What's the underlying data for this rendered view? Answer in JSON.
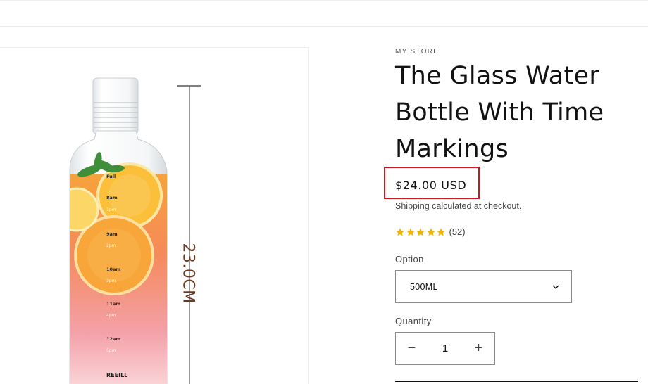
{
  "product": {
    "vendor": "MY STORE",
    "title": "The Glass Water Bottle With Time Markings",
    "price": "$24.00 USD",
    "shipping_link": "Shipping",
    "shipping_rest": " calculated at checkout.",
    "rating_stars": 5,
    "rating_count": "(52)"
  },
  "media": {
    "dimension_label": "23.0CM",
    "brand_on_bottle": "REEILL",
    "bottle_markings": [
      "Full",
      "8am",
      "1pm",
      "9am",
      "2pm",
      "10am",
      "3pm",
      "11am",
      "4pm",
      "12am",
      "5pm"
    ]
  },
  "option": {
    "label": "Option",
    "selected": "500ML"
  },
  "quantity": {
    "label": "Quantity",
    "value": "1",
    "minus": "−",
    "plus": "+"
  },
  "colors": {
    "price_highlight": "#d0161e",
    "star": "#f4b400"
  }
}
